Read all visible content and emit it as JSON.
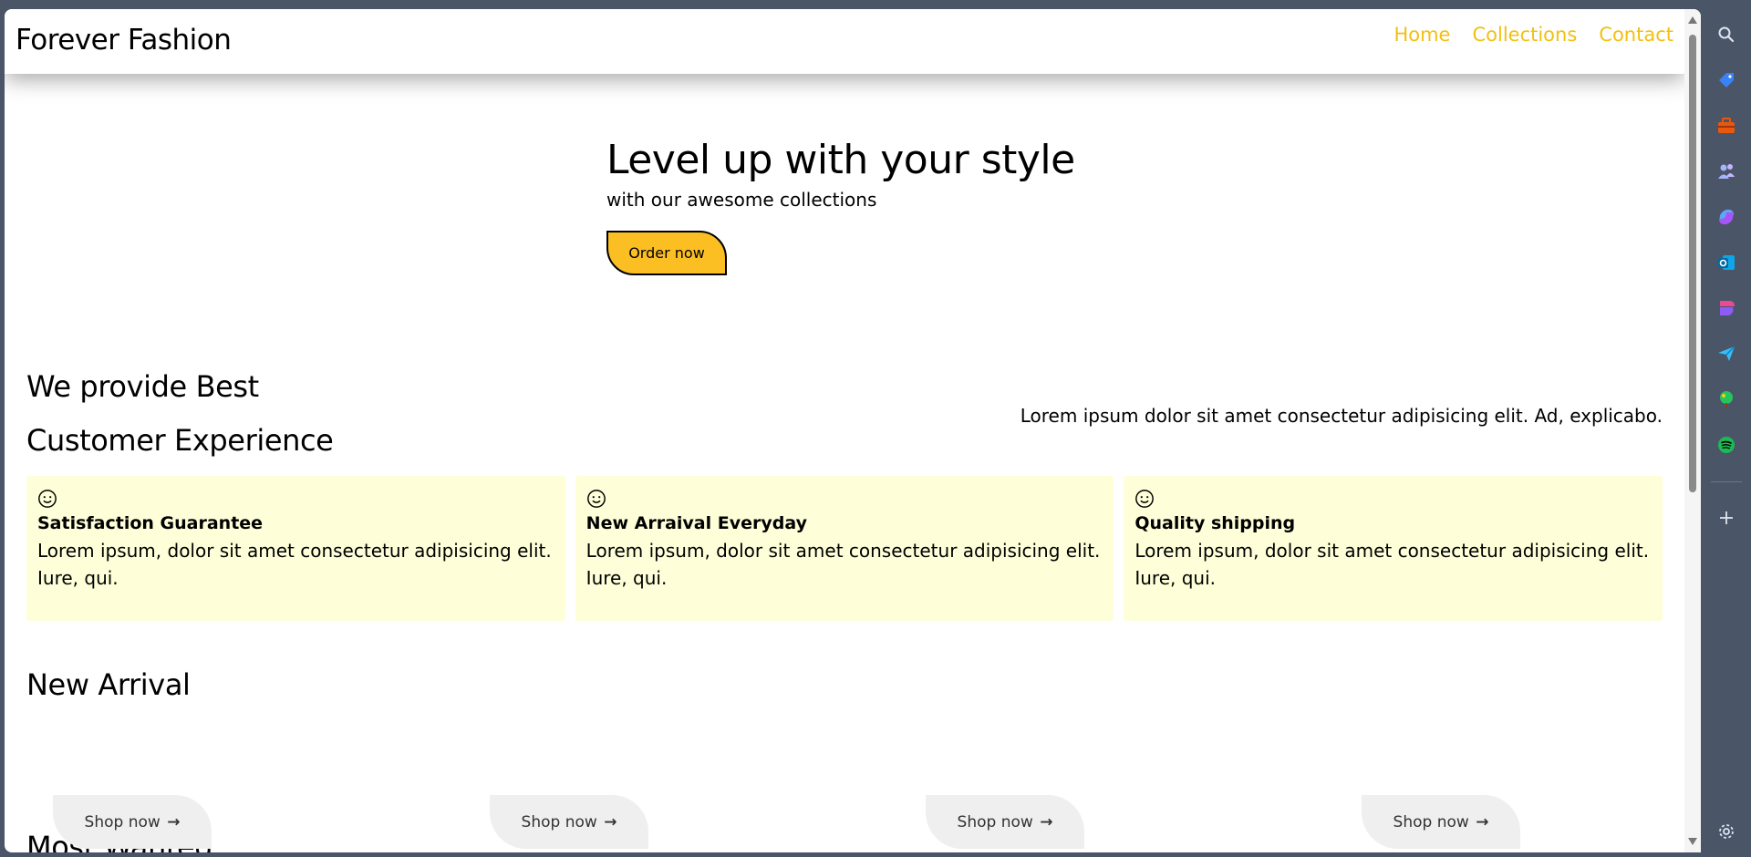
{
  "navbar": {
    "brand": "Forever Fashion",
    "links": [
      "Home",
      "Collections",
      "Contact"
    ]
  },
  "hero": {
    "title": "Level up with your style",
    "subtitle": "with our awesome collections",
    "cta": "Order now"
  },
  "best": {
    "title_line1": "We provide Best",
    "title_line2": "Customer Experience",
    "description": "Lorem ipsum dolor sit amet consectetur adipisicing elit. Ad, explicabo."
  },
  "features": [
    {
      "icon": "smile-icon",
      "title": "Satisfaction Guarantee",
      "text": "Lorem ipsum, dolor sit amet consectetur adipisicing elit. Iure, qui."
    },
    {
      "icon": "smile-icon",
      "title": "New Arraival Everyday",
      "text": "Lorem ipsum, dolor sit amet consectetur adipisicing elit. Iure, qui."
    },
    {
      "icon": "smile-icon",
      "title": "Quality shipping",
      "text": "Lorem ipsum, dolor sit amet consectetur adipisicing elit. Iure, qui."
    }
  ],
  "new_arrival": {
    "title": "New Arrival",
    "shop_label": "Shop now"
  },
  "most_wanted": {
    "title": "Most Wanted"
  },
  "colors": {
    "accent": "#fbbf24",
    "nav_link": "#f2c012",
    "feature_bg": "#feffd9",
    "browser_frame": "#4a5568"
  },
  "sidebar_icons": [
    "search-icon",
    "tag-icon",
    "toolbox-icon",
    "people-icon",
    "copilot-icon",
    "outlook-icon",
    "designer-icon",
    "send-icon",
    "tree-icon",
    "spotify-icon",
    "add-icon",
    "settings-icon"
  ]
}
